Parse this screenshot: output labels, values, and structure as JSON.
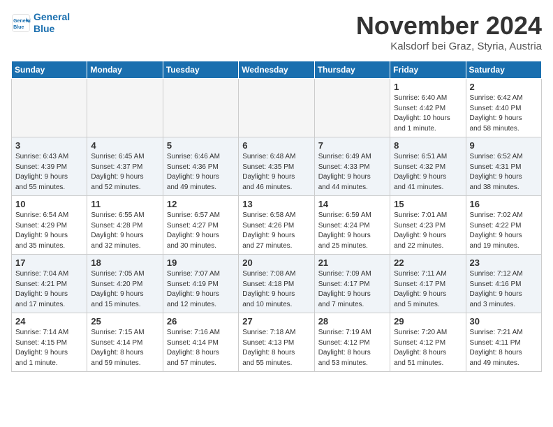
{
  "logo": {
    "line1": "General",
    "line2": "Blue"
  },
  "title": "November 2024",
  "subtitle": "Kalsdorf bei Graz, Styria, Austria",
  "headers": [
    "Sunday",
    "Monday",
    "Tuesday",
    "Wednesday",
    "Thursday",
    "Friday",
    "Saturday"
  ],
  "weeks": [
    [
      {
        "day": "",
        "info": "",
        "empty": true
      },
      {
        "day": "",
        "info": "",
        "empty": true
      },
      {
        "day": "",
        "info": "",
        "empty": true
      },
      {
        "day": "",
        "info": "",
        "empty": true
      },
      {
        "day": "",
        "info": "",
        "empty": true
      },
      {
        "day": "1",
        "info": "Sunrise: 6:40 AM\nSunset: 4:42 PM\nDaylight: 10 hours\nand 1 minute.",
        "empty": false
      },
      {
        "day": "2",
        "info": "Sunrise: 6:42 AM\nSunset: 4:40 PM\nDaylight: 9 hours\nand 58 minutes.",
        "empty": false
      }
    ],
    [
      {
        "day": "3",
        "info": "Sunrise: 6:43 AM\nSunset: 4:39 PM\nDaylight: 9 hours\nand 55 minutes.",
        "empty": false
      },
      {
        "day": "4",
        "info": "Sunrise: 6:45 AM\nSunset: 4:37 PM\nDaylight: 9 hours\nand 52 minutes.",
        "empty": false
      },
      {
        "day": "5",
        "info": "Sunrise: 6:46 AM\nSunset: 4:36 PM\nDaylight: 9 hours\nand 49 minutes.",
        "empty": false
      },
      {
        "day": "6",
        "info": "Sunrise: 6:48 AM\nSunset: 4:35 PM\nDaylight: 9 hours\nand 46 minutes.",
        "empty": false
      },
      {
        "day": "7",
        "info": "Sunrise: 6:49 AM\nSunset: 4:33 PM\nDaylight: 9 hours\nand 44 minutes.",
        "empty": false
      },
      {
        "day": "8",
        "info": "Sunrise: 6:51 AM\nSunset: 4:32 PM\nDaylight: 9 hours\nand 41 minutes.",
        "empty": false
      },
      {
        "day": "9",
        "info": "Sunrise: 6:52 AM\nSunset: 4:31 PM\nDaylight: 9 hours\nand 38 minutes.",
        "empty": false
      }
    ],
    [
      {
        "day": "10",
        "info": "Sunrise: 6:54 AM\nSunset: 4:29 PM\nDaylight: 9 hours\nand 35 minutes.",
        "empty": false
      },
      {
        "day": "11",
        "info": "Sunrise: 6:55 AM\nSunset: 4:28 PM\nDaylight: 9 hours\nand 32 minutes.",
        "empty": false
      },
      {
        "day": "12",
        "info": "Sunrise: 6:57 AM\nSunset: 4:27 PM\nDaylight: 9 hours\nand 30 minutes.",
        "empty": false
      },
      {
        "day": "13",
        "info": "Sunrise: 6:58 AM\nSunset: 4:26 PM\nDaylight: 9 hours\nand 27 minutes.",
        "empty": false
      },
      {
        "day": "14",
        "info": "Sunrise: 6:59 AM\nSunset: 4:24 PM\nDaylight: 9 hours\nand 25 minutes.",
        "empty": false
      },
      {
        "day": "15",
        "info": "Sunrise: 7:01 AM\nSunset: 4:23 PM\nDaylight: 9 hours\nand 22 minutes.",
        "empty": false
      },
      {
        "day": "16",
        "info": "Sunrise: 7:02 AM\nSunset: 4:22 PM\nDaylight: 9 hours\nand 19 minutes.",
        "empty": false
      }
    ],
    [
      {
        "day": "17",
        "info": "Sunrise: 7:04 AM\nSunset: 4:21 PM\nDaylight: 9 hours\nand 17 minutes.",
        "empty": false
      },
      {
        "day": "18",
        "info": "Sunrise: 7:05 AM\nSunset: 4:20 PM\nDaylight: 9 hours\nand 15 minutes.",
        "empty": false
      },
      {
        "day": "19",
        "info": "Sunrise: 7:07 AM\nSunset: 4:19 PM\nDaylight: 9 hours\nand 12 minutes.",
        "empty": false
      },
      {
        "day": "20",
        "info": "Sunrise: 7:08 AM\nSunset: 4:18 PM\nDaylight: 9 hours\nand 10 minutes.",
        "empty": false
      },
      {
        "day": "21",
        "info": "Sunrise: 7:09 AM\nSunset: 4:17 PM\nDaylight: 9 hours\nand 7 minutes.",
        "empty": false
      },
      {
        "day": "22",
        "info": "Sunrise: 7:11 AM\nSunset: 4:17 PM\nDaylight: 9 hours\nand 5 minutes.",
        "empty": false
      },
      {
        "day": "23",
        "info": "Sunrise: 7:12 AM\nSunset: 4:16 PM\nDaylight: 9 hours\nand 3 minutes.",
        "empty": false
      }
    ],
    [
      {
        "day": "24",
        "info": "Sunrise: 7:14 AM\nSunset: 4:15 PM\nDaylight: 9 hours\nand 1 minute.",
        "empty": false
      },
      {
        "day": "25",
        "info": "Sunrise: 7:15 AM\nSunset: 4:14 PM\nDaylight: 8 hours\nand 59 minutes.",
        "empty": false
      },
      {
        "day": "26",
        "info": "Sunrise: 7:16 AM\nSunset: 4:14 PM\nDaylight: 8 hours\nand 57 minutes.",
        "empty": false
      },
      {
        "day": "27",
        "info": "Sunrise: 7:18 AM\nSunset: 4:13 PM\nDaylight: 8 hours\nand 55 minutes.",
        "empty": false
      },
      {
        "day": "28",
        "info": "Sunrise: 7:19 AM\nSunset: 4:12 PM\nDaylight: 8 hours\nand 53 minutes.",
        "empty": false
      },
      {
        "day": "29",
        "info": "Sunrise: 7:20 AM\nSunset: 4:12 PM\nDaylight: 8 hours\nand 51 minutes.",
        "empty": false
      },
      {
        "day": "30",
        "info": "Sunrise: 7:21 AM\nSunset: 4:11 PM\nDaylight: 8 hours\nand 49 minutes.",
        "empty": false
      }
    ]
  ]
}
